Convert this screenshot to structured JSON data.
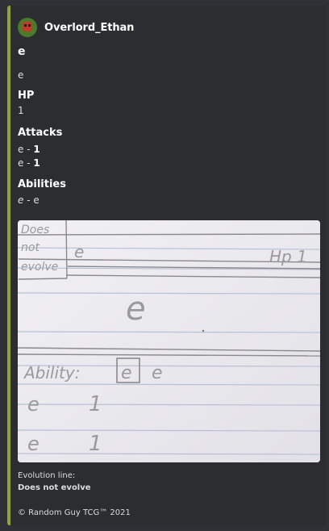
{
  "embed": {
    "accent_color": "#8da635",
    "author": {
      "name": "Overlord_Ethan"
    },
    "title": "e",
    "description": "e",
    "fields": {
      "hp": {
        "name": "HP",
        "value": "1"
      },
      "attacks": {
        "name": "Attacks",
        "items": [
          {
            "name": "e",
            "sep": " - ",
            "damage": "1"
          },
          {
            "name": "e",
            "sep": " - ",
            "damage": "1"
          }
        ]
      },
      "abilities": {
        "name": "Abilities",
        "item": {
          "name": "e",
          "sep": " - ",
          "text": "e"
        }
      }
    },
    "image": {
      "alt": "handwritten card",
      "lines": {
        "evolve_box": [
          "Does",
          "not",
          "evolve"
        ],
        "name": "e",
        "hp": "Hp 1",
        "big_letter": "e",
        "ability_label": "Ability:",
        "ability_boxed": "e",
        "ability_text": "e",
        "attack1_name": "e",
        "attack1_damage": "1",
        "attack2_name": "e",
        "attack2_damage": "1"
      }
    },
    "footer_fields": {
      "evolution_label": "Evolution line:",
      "evolution_value": "Does not evolve"
    },
    "footer": "© Random Guy TCG™ 2021"
  }
}
